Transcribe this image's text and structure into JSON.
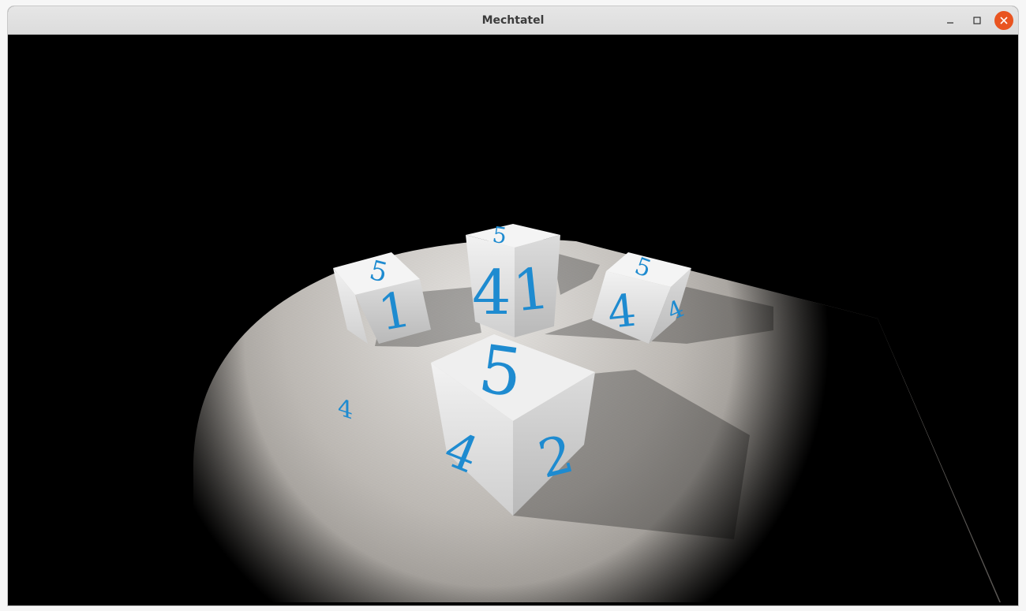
{
  "window": {
    "title": "Mechtatel"
  },
  "scene": {
    "dice": [
      {
        "top": "5",
        "left": "4",
        "right": "1"
      },
      {
        "top": "5",
        "left": "4",
        "right": "1"
      },
      {
        "top": "5",
        "left": "4",
        "right": "4"
      },
      {
        "top": "5",
        "left": "4",
        "right": "2"
      }
    ],
    "colors": {
      "background": "#000000",
      "floor": "#a7a39e",
      "die_face": "#e6e6e6",
      "digit": "#1e8bd0",
      "close_button": "#e95420"
    }
  }
}
